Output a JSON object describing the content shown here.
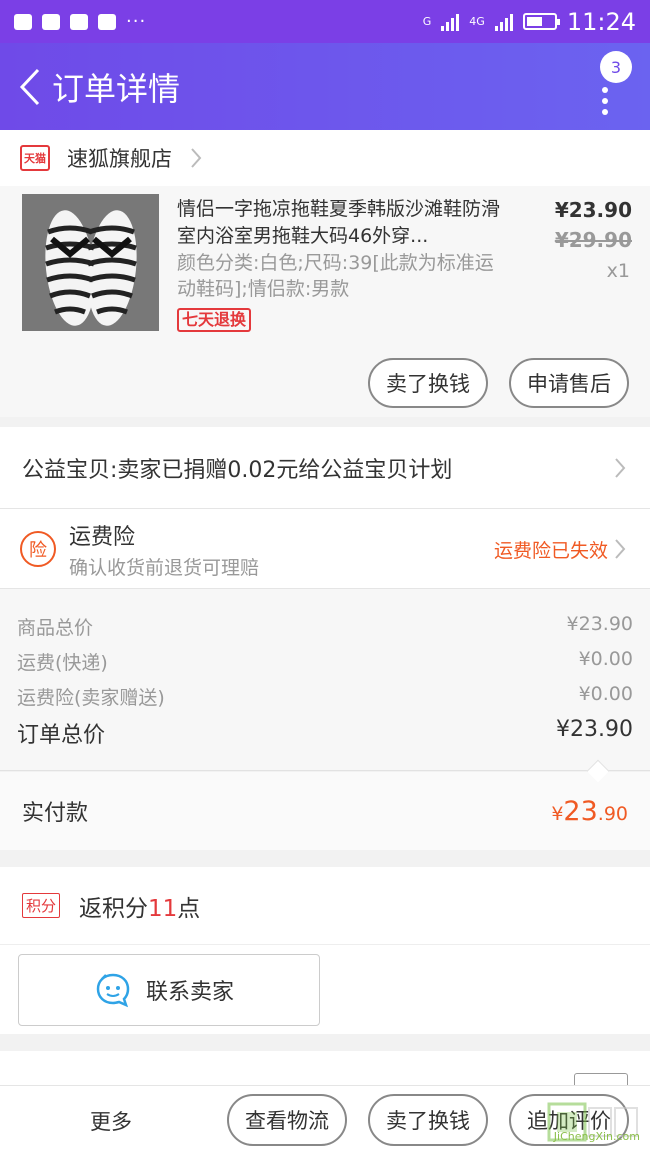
{
  "status_bar": {
    "time": "11:24",
    "network_a": "G",
    "network_b": "4G",
    "sim_1": "1",
    "sim_2": "2",
    "more": "···"
  },
  "header": {
    "title": "订单详情",
    "badge_count": "3"
  },
  "store": {
    "badge": "天猫",
    "name": "速狐旗舰店"
  },
  "product": {
    "title": "情侣一字拖凉拖鞋夏季韩版沙滩鞋防滑室内浴室男拖鞋大码46外穿...",
    "sku": "颜色分类:白色;尺码:39[此款为标准运动鞋码];情侣款:男款",
    "tag": "七天退换",
    "price": "¥23.90",
    "original_price": "¥29.90",
    "quantity": "x1",
    "actions": [
      "卖了换钱",
      "申请售后"
    ]
  },
  "charity": {
    "text": "公益宝贝:卖家已捐赠0.02元给公益宝贝计划"
  },
  "insurance": {
    "icon": "险",
    "title": "运费险",
    "subtitle": "确认收货前退货可理赔",
    "status": "运费险已失效"
  },
  "price_breakdown": {
    "rows": [
      {
        "label": "商品总价",
        "value": "¥23.90"
      },
      {
        "label": "运费(快递)",
        "value": "¥0.00"
      },
      {
        "label": "运费险(卖家赠送)",
        "value": "¥0.00"
      }
    ],
    "total_label": "订单总价",
    "total_value": "¥23.90"
  },
  "payment": {
    "label": "实付款",
    "currency": "¥",
    "amount_int": "23",
    "amount_dec": ".90"
  },
  "points": {
    "tag": "积分",
    "prefix": "返积分",
    "count": "11",
    "suffix": "点"
  },
  "contact": {
    "label": "联系卖家"
  },
  "bottom_bar": {
    "more": "更多",
    "buttons": [
      "查看物流",
      "卖了换钱",
      "追加评价"
    ]
  },
  "watermark": {
    "text": "JiChengXin.com"
  },
  "colors": {
    "header": "#6f4ae8",
    "accent_orange": "#f05a24",
    "accent_red": "#e4393c"
  }
}
